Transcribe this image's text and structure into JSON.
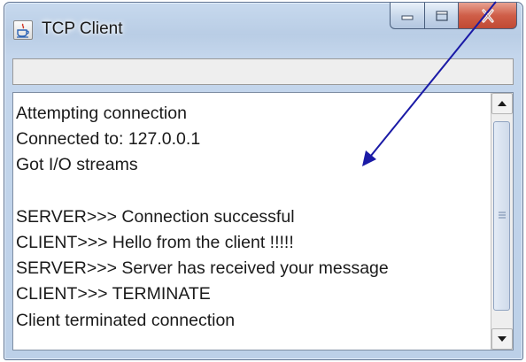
{
  "window": {
    "title": "TCP Client",
    "icon": "java-cup-icon"
  },
  "caption_buttons": [
    {
      "name": "minimize",
      "icon": "minimize-icon"
    },
    {
      "name": "maximize",
      "icon": "maximize-icon"
    },
    {
      "name": "close",
      "icon": "close-icon"
    }
  ],
  "textarea": {
    "lines": [
      "Attempting connection",
      "Connected to: 127.0.0.1",
      "Got I/O streams",
      "",
      "SERVER>>> Connection successful",
      "CLIENT>>> Hello from the client !!!!!",
      "SERVER>>> Server has received your message",
      "CLIENT>>> TERMINATE",
      "Client terminated connection"
    ]
  },
  "scrollbar": {
    "up_icon": "arrow-up-icon",
    "down_icon": "arrow-down-icon"
  },
  "colors": {
    "annotation_arrow": "#1a1aa6",
    "close_button": "#c8503a",
    "frame": "#bcd0e8"
  }
}
